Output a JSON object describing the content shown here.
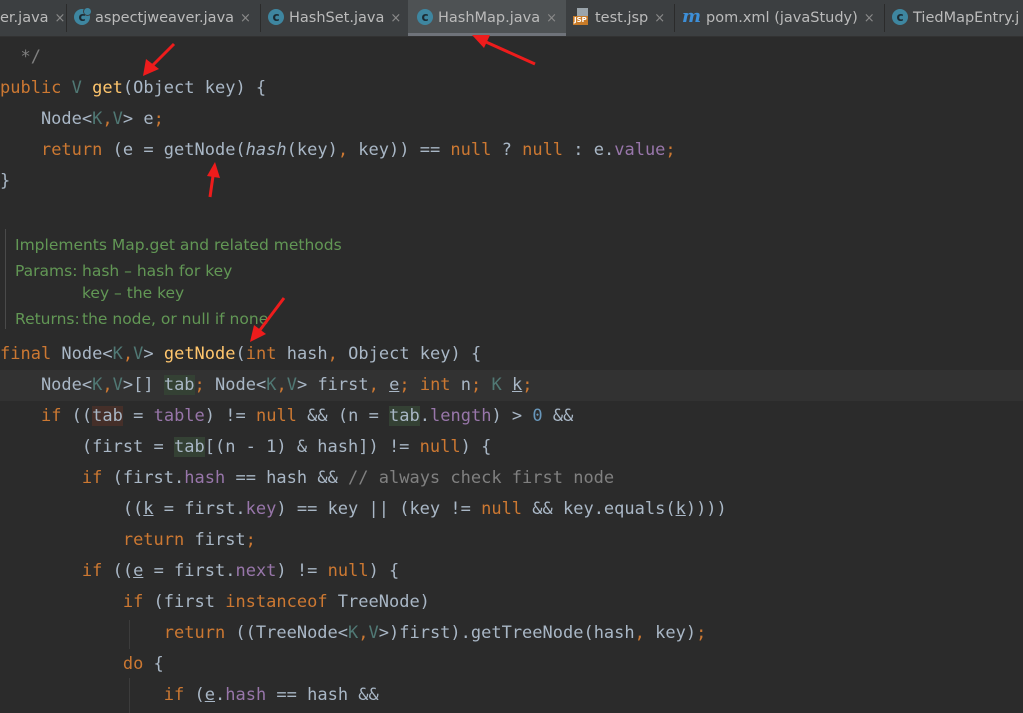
{
  "tabs": [
    {
      "label": "er.java",
      "icon": "class-icon",
      "active": false
    },
    {
      "label": "aspectjweaver.java",
      "icon": "class-icon",
      "active": false
    },
    {
      "label": "HashSet.java",
      "icon": "class-icon",
      "active": false
    },
    {
      "label": "HashMap.java",
      "icon": "class-icon",
      "active": true
    },
    {
      "label": "test.jsp",
      "icon": "jsp-file-icon",
      "active": false
    },
    {
      "label": "pom.xml (javaStudy)",
      "icon": "maven-icon",
      "active": false
    },
    {
      "label": "TiedMapEntry.j",
      "icon": "class-icon",
      "active": false
    }
  ],
  "jsp_icon_label": "JSP",
  "maven_icon_glyph": "m",
  "close_glyph": "×",
  "doc": {
    "summary": "Implements Map.get and related methods",
    "params_label": "Params:",
    "param1": "hash – hash for key",
    "param2": "key – the key",
    "returns_label": "Returns:",
    "returns": "the node, or null if none"
  },
  "code": {
    "l0": [
      [
        "cm",
        "  */"
      ]
    ],
    "l1": [
      [
        "kw",
        "public "
      ],
      [
        "tp",
        "V "
      ],
      [
        "fn",
        "get"
      ],
      [
        "",
        "(Object key) {"
      ]
    ],
    "l2": [
      [
        "",
        "    Node<"
      ],
      [
        "tp",
        "K"
      ],
      [
        "kw",
        ","
      ],
      [
        "tp",
        "V"
      ],
      [
        "",
        "> e"
      ],
      [
        "kw",
        ";"
      ]
    ],
    "l3": [
      [
        "",
        "    "
      ],
      [
        "kw",
        "return "
      ],
      [
        "",
        "(e = getNode("
      ],
      [
        "it",
        "hash"
      ],
      [
        "",
        "(key)"
      ],
      [
        "kw",
        ", "
      ],
      [
        "",
        "key)) == "
      ],
      [
        "kw",
        "null "
      ],
      [
        "",
        "? "
      ],
      [
        "kw",
        "null "
      ],
      [
        "",
        ": e."
      ],
      [
        "fl",
        "value"
      ],
      [
        "kw",
        ";"
      ]
    ],
    "l4": [
      [
        "",
        "}"
      ]
    ],
    "l5": [
      [
        "kw",
        "final "
      ],
      [
        "",
        "Node<"
      ],
      [
        "tp",
        "K"
      ],
      [
        "kw",
        ","
      ],
      [
        "tp",
        "V"
      ],
      [
        "",
        "> "
      ],
      [
        "fn",
        "getNode"
      ],
      [
        "",
        "("
      ],
      [
        "kw",
        "int "
      ],
      [
        "",
        "hash"
      ],
      [
        "kw",
        ", "
      ],
      [
        "",
        "Object key) {"
      ]
    ],
    "l6": [
      [
        "",
        "    Node<"
      ],
      [
        "tp",
        "K"
      ],
      [
        "kw",
        ","
      ],
      [
        "tp",
        "V"
      ],
      [
        "",
        ">[] "
      ],
      [
        "hl",
        "tab"
      ],
      [
        "kw",
        "; "
      ],
      [
        "",
        "Node<"
      ],
      [
        "tp",
        "K"
      ],
      [
        "kw",
        ","
      ],
      [
        "tp",
        "V"
      ],
      [
        "",
        "> first"
      ],
      [
        "kw",
        ", "
      ],
      [
        "ul",
        "e"
      ],
      [
        "kw",
        "; int "
      ],
      [
        "",
        "n"
      ],
      [
        "kw",
        "; "
      ],
      [
        "tp",
        "K "
      ],
      [
        "ul",
        "k"
      ],
      [
        "kw",
        ";"
      ]
    ],
    "l7": [
      [
        "",
        "    "
      ],
      [
        "kw",
        "if "
      ],
      [
        "",
        "(("
      ],
      [
        "hl2",
        "tab"
      ],
      [
        "",
        " = "
      ],
      [
        "fl",
        "table"
      ],
      [
        "",
        ") != "
      ],
      [
        "kw",
        "null "
      ],
      [
        "",
        "&& (n = "
      ],
      [
        "hl",
        "tab"
      ],
      [
        "",
        "."
      ],
      [
        "fl",
        "length"
      ],
      [
        "",
        ") > "
      ],
      [
        "num",
        "0 "
      ],
      [
        "",
        "&&"
      ]
    ],
    "l8": [
      [
        "",
        "        (first = "
      ],
      [
        "hl",
        "tab"
      ],
      [
        "",
        "[(n - 1) & hash]) != "
      ],
      [
        "kw",
        "null"
      ],
      [
        "",
        ") {"
      ]
    ],
    "l9": [
      [
        "",
        "        "
      ],
      [
        "kw",
        "if "
      ],
      [
        "",
        "(first."
      ],
      [
        "fl",
        "hash"
      ],
      [
        "",
        " == hash && "
      ],
      [
        "cm",
        "// always check first node"
      ]
    ],
    "l10": [
      [
        "",
        "            (("
      ],
      [
        "ul",
        "k"
      ],
      [
        "",
        " = first."
      ],
      [
        "fl",
        "key"
      ],
      [
        "",
        ") == key || (key != "
      ],
      [
        "kw",
        "null "
      ],
      [
        "",
        "&& key.equals("
      ],
      [
        "ul",
        "k"
      ],
      [
        "",
        "))))"
      ]
    ],
    "l11": [
      [
        "",
        "            "
      ],
      [
        "kw",
        "return "
      ],
      [
        "",
        "first"
      ],
      [
        "kw",
        ";"
      ]
    ],
    "l12": [
      [
        "",
        "        "
      ],
      [
        "kw",
        "if "
      ],
      [
        "",
        "(("
      ],
      [
        "ul",
        "e"
      ],
      [
        "",
        " = first."
      ],
      [
        "fl",
        "next"
      ],
      [
        "",
        ") != "
      ],
      [
        "kw",
        "null"
      ],
      [
        "",
        ") {"
      ]
    ],
    "l13": [
      [
        "",
        "            "
      ],
      [
        "kw",
        "if "
      ],
      [
        "",
        "(first "
      ],
      [
        "kw",
        "instanceof "
      ],
      [
        "",
        "TreeNode)"
      ]
    ],
    "l14": [
      [
        "",
        "                "
      ],
      [
        "kw",
        "return "
      ],
      [
        "",
        "((TreeNode<"
      ],
      [
        "tp",
        "K"
      ],
      [
        "kw",
        ","
      ],
      [
        "tp",
        "V"
      ],
      [
        "",
        ">)first).getTreeNode(hash"
      ],
      [
        "kw",
        ", "
      ],
      [
        "",
        "key)"
      ],
      [
        "kw",
        ";"
      ]
    ],
    "l15": [
      [
        "",
        "            "
      ],
      [
        "kw",
        "do "
      ],
      [
        "",
        "{"
      ]
    ],
    "l16": [
      [
        "",
        "                "
      ],
      [
        "kw",
        "if "
      ],
      [
        "",
        "("
      ],
      [
        "ul",
        "e"
      ],
      [
        "",
        "."
      ],
      [
        "fl",
        "hash"
      ],
      [
        "",
        " == hash &&"
      ]
    ]
  }
}
